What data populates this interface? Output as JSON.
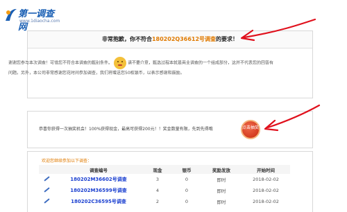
{
  "logo": {
    "name": "第一调查网",
    "url": "www.1diaocha.com"
  },
  "notice": {
    "prefix": "非常抱歉，你不符合",
    "survey_no": "180202Q36612号调查",
    "suffix": "的要求！",
    "body_a": "谢谢您参与本次调查！可惜您不符合本调查的甄别条件。",
    "body_b": "请不要介意，甄选过程本就是商业调查的一个组成部分，这并不代表您的回答有问题。另外，本公司非常感谢您花时间参加调查，我们将赠送您50枚银币，以表示感谢和鼓励。"
  },
  "lottery": {
    "message": "恭喜你获得一次抽奖机会！100%获得现金，最高可获得200元！！奖金数量有限，先到先得哦",
    "button_label": "点击抽奖"
  },
  "surveys": {
    "invite_text": "欢迎您继续参加以下调查：",
    "columns": [
      "",
      "调查编号",
      "现金",
      "银币",
      "奖励发放",
      "开始时间"
    ],
    "rows": [
      {
        "id": "180202M36602号调查",
        "cash": "3",
        "coins": "0",
        "payout": "即时",
        "start": "2018-02-02"
      },
      {
        "id": "180202M36599号调查",
        "cash": "4",
        "coins": "0",
        "payout": "即时",
        "start": "2018-02-02"
      },
      {
        "id": "180202C36595号调查",
        "cash": "2",
        "coins": "0",
        "payout": "即时",
        "start": "2018-02-02"
      }
    ]
  },
  "colors": {
    "accent_orange": "#e07a00",
    "link_blue": "#1a3fd0",
    "annotation_red": "#e0101c"
  },
  "icons": [
    "logo-mark-icon",
    "sad-face-icon",
    "edit-pen-icon"
  ]
}
